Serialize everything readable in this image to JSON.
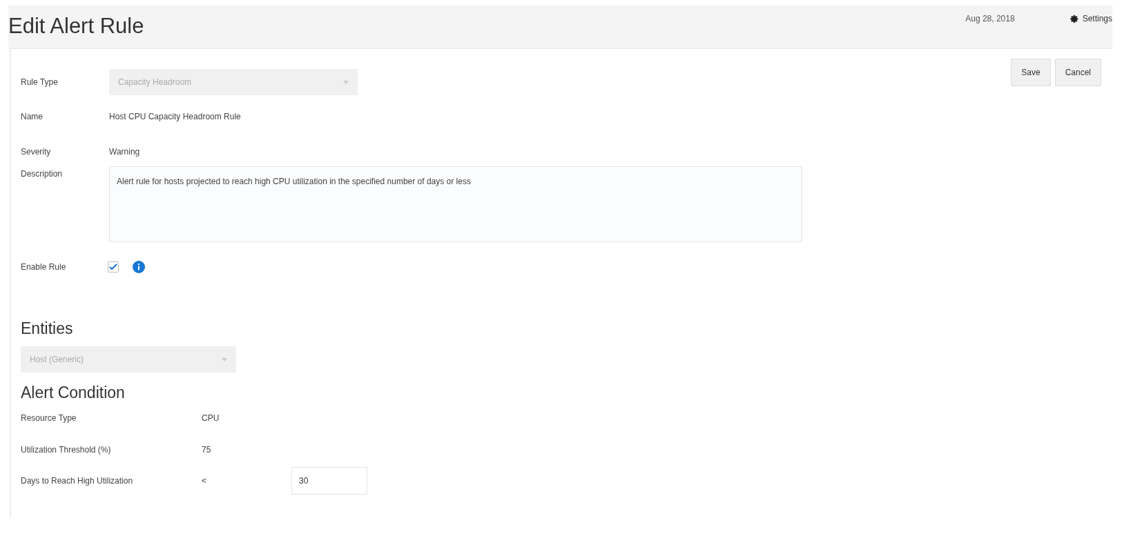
{
  "header": {
    "title": "Edit Alert Rule",
    "date": "Aug 28, 2018",
    "settings": "Settings"
  },
  "actions": [
    {
      "label": "Save"
    },
    {
      "label": "Cancel"
    }
  ],
  "rule_type": {
    "label": "Rule Type",
    "value": "Capacity Headroom",
    "disabled": true
  },
  "name": {
    "label": "Name",
    "value": "Host CPU Capacity Headroom Rule"
  },
  "severity": {
    "label": "Severity",
    "value": "Warning"
  },
  "description": {
    "label": "Description",
    "value": "Alert rule for hosts projected to reach high CPU utilization in the specified number of days or less"
  },
  "enable_rule": {
    "label": "Enable Rule",
    "checked": true
  },
  "entities": {
    "heading": "Entities",
    "value": "Host (Generic)",
    "disabled": true
  },
  "alert_condition": {
    "heading": "Alert Condition",
    "rows": [
      {
        "label": "Resource Type",
        "value": "CPU"
      },
      {
        "label": "Utilization Threshold (%)",
        "value": "75"
      }
    ],
    "days": {
      "label": "Days to Reach High Utilization",
      "operator": "<",
      "value": "30"
    }
  }
}
